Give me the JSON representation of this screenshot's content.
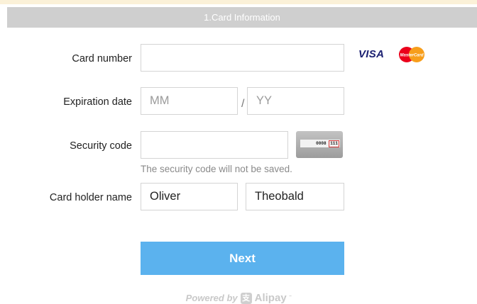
{
  "section": {
    "title": "1.Card Information"
  },
  "card_number": {
    "label": "Card number",
    "value": "",
    "placeholder": ""
  },
  "card_brands": {
    "visa": "VISA",
    "mastercard": "MasterCard"
  },
  "expiration": {
    "label": "Expiration date",
    "month_placeholder": "MM",
    "year_placeholder": "YY",
    "separator": "/"
  },
  "security": {
    "label": "Security code",
    "value": "",
    "note": "The security code will not be saved.",
    "card_example": {
      "number": "0008",
      "cvv": "111"
    }
  },
  "holder": {
    "label": "Card holder name",
    "first_name": "Oliver",
    "last_name": "Theobald"
  },
  "actions": {
    "next": "Next"
  },
  "footer": {
    "powered_by": "Powered by",
    "brand": "Alipay",
    "trademark": "˜"
  },
  "colors": {
    "header_bg": "#cfcfcf",
    "button": "#5bb2ee",
    "visa": "#1a1f71",
    "mc_red": "#eb001b",
    "mc_yellow": "#f79e1b"
  }
}
